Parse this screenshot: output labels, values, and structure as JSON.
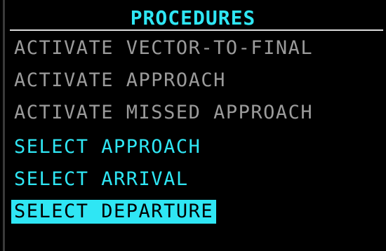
{
  "title": "PROCEDURES",
  "items": [
    {
      "label": "ACTIVATE VECTOR-TO-FINAL",
      "state": "disabled"
    },
    {
      "label": "ACTIVATE APPROACH",
      "state": "disabled"
    },
    {
      "label": "ACTIVATE MISSED APPROACH",
      "state": "disabled"
    },
    {
      "label": "SELECT APPROACH",
      "state": "enabled"
    },
    {
      "label": "SELECT ARRIVAL",
      "state": "enabled"
    },
    {
      "label": "SELECT DEPARTURE",
      "state": "selected"
    }
  ],
  "colors": {
    "accent": "#2fe6f4",
    "disabled": "#9b9b9b",
    "background": "#000000"
  }
}
